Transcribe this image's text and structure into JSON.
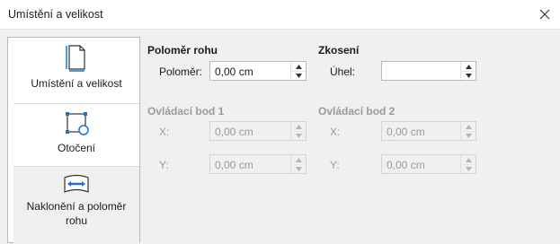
{
  "window": {
    "title": "Umístění a velikost"
  },
  "sidebar": {
    "items": [
      {
        "label": "Umístění a velikost",
        "icon": "position-size-icon"
      },
      {
        "label": "Otočení",
        "icon": "rotation-icon"
      },
      {
        "label": "Naklonění a poloměr rohu",
        "label_line1": "Naklonění a poloměr",
        "label_line2": "rohu",
        "icon": "slant-icon"
      }
    ]
  },
  "corner_radius": {
    "title": "Poloměr rohu",
    "radius_label": "Poloměr:",
    "radius_value": "0,00 cm"
  },
  "slant": {
    "title": "Zkosení",
    "angle_label": "Úhel:",
    "angle_value": ""
  },
  "control_point_1": {
    "title": "Ovládací bod 1",
    "x_label": "X:",
    "x_value": "0,00 cm",
    "y_label": "Y:",
    "y_value": "0,00 cm"
  },
  "control_point_2": {
    "title": "Ovládací bod 2",
    "x_label": "X:",
    "x_value": "0,00 cm",
    "y_label": "Y:",
    "y_value": "0,00 cm"
  },
  "colors": {
    "accent": "#1a74c9",
    "disabled_text": "#9a9a9a",
    "background": "#f0f0f0"
  }
}
